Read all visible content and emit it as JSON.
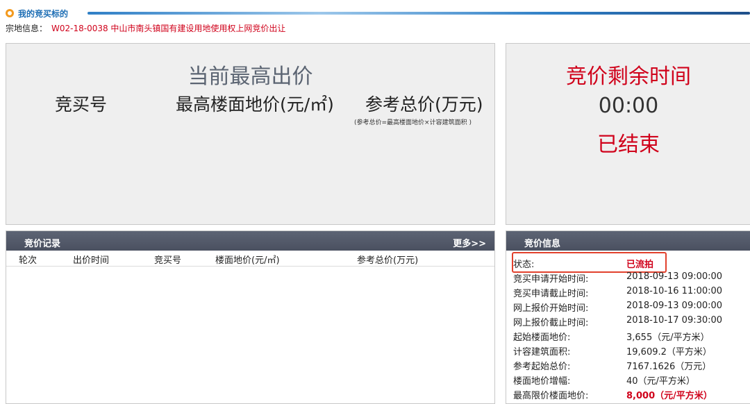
{
  "header": {
    "title": "我的竞买标的",
    "parcel_label": "宗地信息：",
    "parcel_value": "W02-18-0038 中山市南头镇国有建设用地使用权上网竞价出让"
  },
  "highest_bid": {
    "title": "当前最高出价",
    "col_bid_no": "竞买号",
    "col_floor_price": "最高楼面地价(元/㎡)",
    "col_total": "参考总价(万元)",
    "note": "(参考总价=最高楼面地价×计容建筑面积 )"
  },
  "countdown": {
    "title": "竞价剩余时间",
    "time": "00:00",
    "state": "已结束"
  },
  "records": {
    "title": "竞价记录",
    "more": "更多>>",
    "columns": [
      "轮次",
      "出价时间",
      "竞买号",
      "楼面地价(元/㎡)",
      "参考总价(万元)"
    ]
  },
  "info": {
    "title": "竞价信息",
    "rows": [
      {
        "k": "状态:",
        "v": "已流拍"
      },
      {
        "k": "竞买申请开始时间:",
        "v": "2018-09-13 09:00:00"
      },
      {
        "k": "竞买申请截止时间:",
        "v": "2018-10-16 11:00:00"
      },
      {
        "k": "网上报价开始时间:",
        "v": "2018-09-13 09:00:00"
      },
      {
        "k": "网上报价截止时间:",
        "v": "2018-10-17 09:30:00"
      },
      {
        "k": "起始楼面地价:",
        "v": "3,655（元/平方米）"
      },
      {
        "k": "计容建筑面积:",
        "v": "19,609.2（平方米）"
      },
      {
        "k": "参考起始总价:",
        "v": "7167.1626（万元）"
      },
      {
        "k": "楼面地价增幅:",
        "v": "40（元/平方米）"
      },
      {
        "k": "最高限价楼面地价:",
        "v": "8,000（元/平方米）"
      }
    ]
  },
  "colors": {
    "accent_red": "#d0021b",
    "header_blue": "#1f6fb5",
    "bar_gray": "#4f5565"
  }
}
